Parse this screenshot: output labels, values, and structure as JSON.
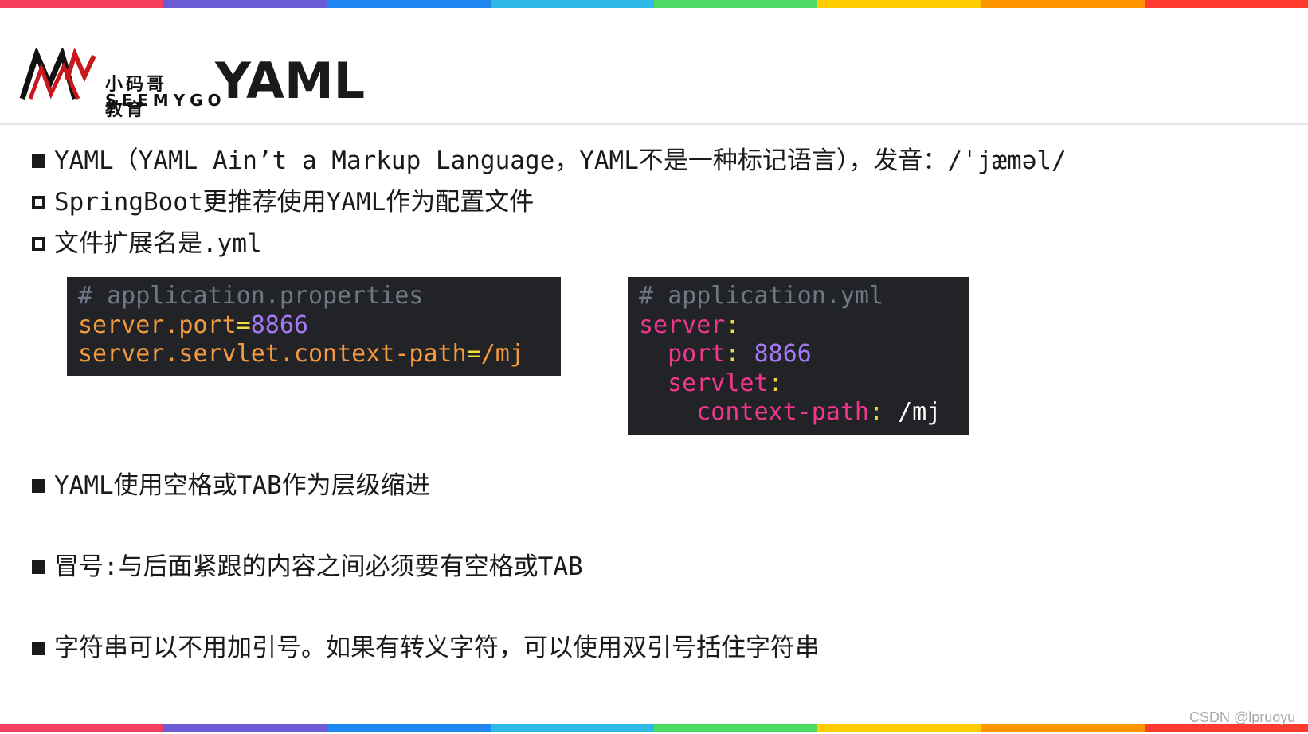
{
  "stripe_colors": [
    "#f43f5e",
    "#6b5bd6",
    "#1e88f0",
    "#2fb9e6",
    "#4cd964",
    "#ffcc00",
    "#ff9500",
    "#ff3b30"
  ],
  "logo": {
    "cn": "小码哥教育",
    "en": "SEEMYGO"
  },
  "title": "YAML",
  "bullets": [
    {
      "text": "YAML（YAML Ain’t a Markup Language，YAML不是一种标记语言），发音：/ˈjæməl/"
    },
    {
      "text": "SpringBoot更推荐使用YAML作为配置文件"
    },
    {
      "text": "文件扩展名是.yml"
    },
    {
      "text": "YAML使用空格或TAB作为层级缩进"
    },
    {
      "text": "冒号:与后面紧跟的内容之间必须要有空格或TAB"
    },
    {
      "text": "字符串可以不用加引号。如果有转义字符，可以使用双引号括住字符串"
    }
  ],
  "properties_code": {
    "comment": "# application.properties",
    "l1_key": "server.port",
    "l1_op": "=",
    "l1_val": "8866",
    "l2_key": "server.servlet.context-path",
    "l2_op": "=",
    "l2_val": "/mj"
  },
  "yml_code": {
    "comment": "# application.yml",
    "k_server": "server",
    "k_port": "port",
    "v_port": "8866",
    "k_servlet": "servlet",
    "k_context": "context-path",
    "v_context": "/mj",
    "colon": ":"
  },
  "watermark": "CSDN @lpruoyu"
}
